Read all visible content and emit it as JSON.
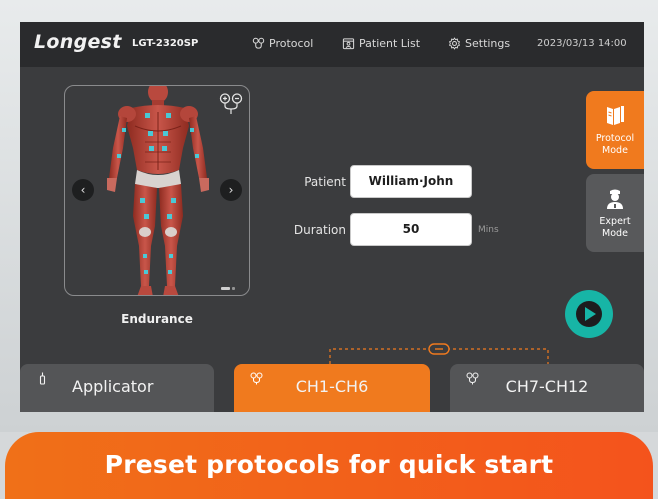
{
  "topbar": {
    "brand": "Longest",
    "model": "LGT-2320SP",
    "nav": [
      {
        "label": "Protocol",
        "icon": "electrode-icon"
      },
      {
        "label": "Patient List",
        "icon": "patient-list-icon"
      },
      {
        "label": "Settings",
        "icon": "gear-icon"
      }
    ],
    "datetime": "2023/03/13 14:00"
  },
  "protocol_panel": {
    "name": "Endurance",
    "prev_icon": "‹",
    "next_icon": "›",
    "pager": {
      "pages": 2,
      "current": 1
    }
  },
  "form": {
    "patient_label": "Patient",
    "patient_value": "William·John",
    "duration_label": "Duration",
    "duration_value": "50",
    "duration_unit": "Mins"
  },
  "modes": {
    "protocol_line1": "Protocol",
    "protocol_line2": "Mode",
    "expert_line1": "Expert",
    "expert_line2": "Mode",
    "active": "protocol"
  },
  "tabs": {
    "applicator": "Applicator",
    "ch1": "CH1-CH6",
    "ch7": "CH7-CH12",
    "active": "ch1"
  },
  "banner": {
    "text": "Preset protocols for quick start"
  },
  "colors": {
    "accent": "#f07a1e",
    "play": "#17b5a6",
    "screen_bg": "#3b3c3e",
    "topbar_bg": "#2a2b2d",
    "electrode": "#3fd6e6"
  }
}
